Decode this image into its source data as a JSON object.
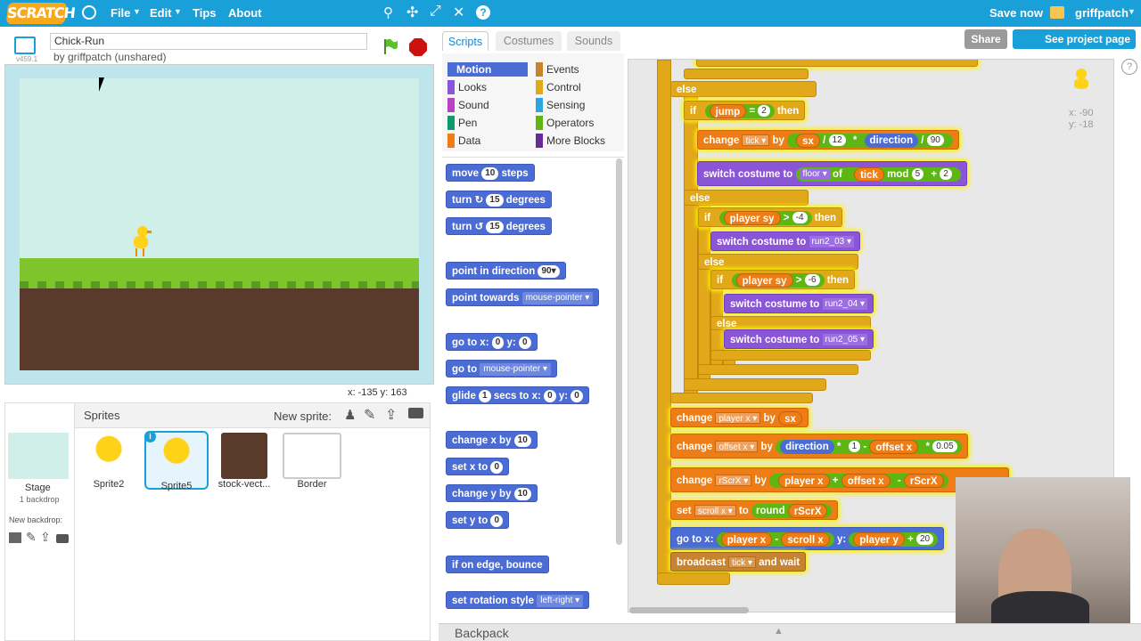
{
  "topbar": {
    "logo": "SCRATCH",
    "file": "File",
    "edit": "Edit",
    "tips": "Tips",
    "about": "About",
    "save_now": "Save now",
    "user": "griffpatch"
  },
  "project": {
    "title": "Chick-Run",
    "byline": "by griffpatch (unshared)",
    "version": "v459.1"
  },
  "share": {
    "share": "Share",
    "see_page": "See project page"
  },
  "stage": {
    "coords": "x: -135   y: 163"
  },
  "tabs": {
    "scripts": "Scripts",
    "costumes": "Costumes",
    "sounds": "Sounds"
  },
  "categories": {
    "motion": "Motion",
    "looks": "Looks",
    "sound": "Sound",
    "pen": "Pen",
    "data": "Data",
    "events": "Events",
    "control": "Control",
    "sensing": "Sensing",
    "operators": "Operators",
    "more": "More Blocks"
  },
  "palette": {
    "move": "move",
    "move_n": "10",
    "steps": "steps",
    "turn": "turn",
    "turn_n": "15",
    "degrees": "degrees",
    "point_dir": "point in direction",
    "dir_n": "90▾",
    "point_towards": "point towards",
    "mouse_pointer": "mouse-pointer ▾",
    "goto_x": "go to x:",
    "gx": "0",
    "y": "y:",
    "gy": "0",
    "goto": "go to",
    "glide": "glide",
    "glide_n": "1",
    "glide_secs": "secs to x:",
    "change_x": "change x by",
    "cx": "10",
    "set_x": "set x to",
    "sx": "0",
    "change_y": "change y by",
    "cy": "10",
    "set_y": "set y to",
    "sy": "0",
    "bounce": "if on edge, bounce",
    "rot": "set rotation style",
    "rot_v": "left-right ▾"
  },
  "sprites": {
    "header": "Sprites",
    "new_sprite": "New sprite:",
    "stage": "Stage",
    "backdrops": "1 backdrop",
    "new_backdrop": "New backdrop:",
    "items": [
      "Sprite2",
      "Sprite5",
      "stock-vect...",
      "Border"
    ]
  },
  "script": {
    "else": "else",
    "if": "if",
    "then": "then",
    "jump": "jump",
    "eq": "=",
    "two": "2",
    "change": "change",
    "tick": "tick ▾",
    "by": "by",
    "sx": "sx",
    "div": "/",
    "twelve": "12",
    "mul": "*",
    "direction": "direction",
    "ninety": "90",
    "switch": "switch costume to",
    "floor": "floor ▾",
    "of": "of",
    "tick_r": "tick",
    "mod": "mod",
    "five": "5",
    "plus": "+",
    "player_sy": "player sy",
    "gt": ">",
    "m4": "-4",
    "run03": "run2_03 ▾",
    "m6": "-6",
    "run04": "run2_04 ▾",
    "run05": "run2_05 ▾",
    "player_x_d": "player x ▾",
    "offset_x_d": "offset x ▾",
    "one": "1",
    "minus": "-",
    "offset_x": "offset x",
    "p05": "0.05",
    "rscrx_d": "rScrX ▾",
    "player_x": "player x",
    "rscrx": "rScrX",
    "set": "set",
    "scroll_x_d": "scroll x ▾",
    "to": "to",
    "round": "round",
    "goto_x": "go to x:",
    "scroll_x": "scroll x",
    "y": "y:",
    "player_y": "player y",
    "twenty": "20",
    "broadcast": "broadcast",
    "tick_d": "tick ▾",
    "and_wait": "and wait"
  },
  "sprite_info": {
    "x": "x: -90",
    "y": "y: -18"
  },
  "backpack": "Backpack"
}
